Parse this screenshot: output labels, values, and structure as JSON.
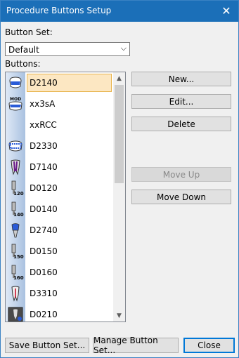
{
  "window": {
    "title": "Procedure Buttons Setup"
  },
  "button_set": {
    "label": "Button Set:",
    "selected": "Default"
  },
  "buttons_list": {
    "label": "Buttons:",
    "items": [
      {
        "code": "D2140",
        "icon": "tooth-crown-filling-icon",
        "selected": true
      },
      {
        "code": "xx3sA",
        "icon": "tooth-mod-icon",
        "selected": false
      },
      {
        "code": "xxRCC",
        "icon": "",
        "selected": false
      },
      {
        "code": "D2330",
        "icon": "tooth-crown-hatched-icon",
        "selected": false
      },
      {
        "code": "D7140",
        "icon": "tooth-root-icon",
        "selected": false
      },
      {
        "code": "D0120",
        "icon": "implant-120-icon",
        "selected": false
      },
      {
        "code": "D0140",
        "icon": "implant-140-icon",
        "selected": false
      },
      {
        "code": "D2740",
        "icon": "crown-post-icon",
        "selected": false
      },
      {
        "code": "D0150",
        "icon": "implant-150-icon",
        "selected": false
      },
      {
        "code": "D0160",
        "icon": "implant-160-icon",
        "selected": false
      },
      {
        "code": "D3310",
        "icon": "tooth-root-canal-icon",
        "selected": false
      },
      {
        "code": "D0210",
        "icon": "xray-icon",
        "selected": false
      }
    ]
  },
  "actions": {
    "new": "New...",
    "edit": "Edit...",
    "delete": "Delete",
    "move_up": "Move Up",
    "move_down": "Move Down"
  },
  "footer": {
    "save": "Save Button Set...",
    "manage": "Manage Button Set...",
    "close": "Close"
  },
  "colors": {
    "titlebar": "#1b6fb8",
    "selection": "#fce7c2",
    "selection_border": "#e8b44d"
  }
}
